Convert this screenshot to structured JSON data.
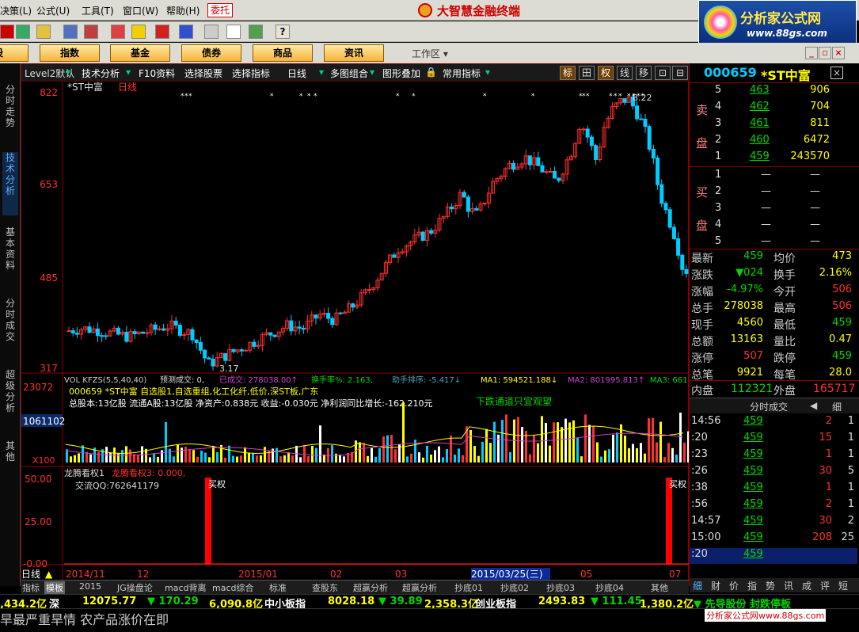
{
  "menu": {
    "items": [
      "决策(L)",
      "公式(U)",
      "工具(T)",
      "窗口(W)",
      "帮助(H)"
    ],
    "entrust": "委托",
    "app_title": "大智慧金融终端"
  },
  "brand": {
    "name": "分析家公式网",
    "url": "www.88gs.com"
  },
  "nav": {
    "buttons": [
      "股",
      "指数",
      "基金",
      "债券",
      "商品",
      "资讯"
    ],
    "workarea": "工作区"
  },
  "left_tabs": [
    "分时走势",
    "技术分析",
    "基本资料",
    "分时成交",
    "超级分析",
    "其他"
  ],
  "chart_tools": {
    "items": [
      "Level2默认",
      "技术分析",
      "F10资料",
      "选择股票",
      "选择指标",
      "日线",
      "多图组合",
      "图形叠加",
      "常用指标"
    ],
    "right": [
      "标",
      "田",
      "权",
      "线",
      "移",
      "⊡",
      "⊟"
    ]
  },
  "stock": {
    "code": "000659",
    "name": "*ST中富"
  },
  "chart_data": [
    {
      "type": "candlestick",
      "title": "*ST中富",
      "period": "日线",
      "y_ticks": [
        "822",
        "653",
        "485",
        "317"
      ],
      "ylim": [
        317,
        822
      ],
      "annotations": {
        "high": "8.22",
        "low": "3.17"
      },
      "x_ticks": [
        "2014/11",
        "12",
        "2015/01",
        "02",
        "03",
        "2015/03/25(三)",
        "05",
        "07"
      ]
    },
    {
      "type": "bar",
      "title": "VOL KFZS(5,5,40,40)",
      "y_ticks": [
        "23072",
        "1061102",
        "X100"
      ],
      "line1": {
        "l1": "预测成交: 0,",
        "l2": "已成交: 278038.00↑",
        "l3": "换手率%: 2.163,",
        "l4": "助手排序: -5.417↓",
        "l5": "MA1: 594521.188↓",
        "l6": "MA2: 801995.813↑",
        "l7": "MA3: 661"
      },
      "info1": "000659 *ST中富  自选股1,自选重组,化工化纤,低价,深ST板,广东",
      "info2": "总股本:13亿股  流通A股:13亿股   净资产:0.838元   收益:-0.030元   净利润同比增长:-162.210元",
      "info3": "下跌通道只宜观望"
    },
    {
      "type": "bar",
      "title": "龙腾看权1",
      "subtitle": "龙腾看权3: 0.000,",
      "note": "交流QQ:762641179",
      "y_ticks": [
        "50.00",
        "25.00",
        "-0.00"
      ],
      "bar_label": "买权",
      "signals": [
        {
          "x": "2014/12",
          "value": 100
        },
        {
          "x": "07",
          "value": 100
        }
      ]
    }
  ],
  "quote": {
    "sell": [
      {
        "level": "5",
        "price": "463",
        "vol": "906"
      },
      {
        "level": "4",
        "price": "462",
        "vol": "704"
      },
      {
        "level": "3",
        "price": "461",
        "vol": "811"
      },
      {
        "level": "2",
        "price": "460",
        "vol": "6472"
      },
      {
        "level": "1",
        "price": "459",
        "vol": "243570"
      }
    ],
    "buy": [
      {
        "level": "1",
        "price": "—",
        "vol": "—"
      },
      {
        "level": "2",
        "price": "—",
        "vol": "—"
      },
      {
        "level": "3",
        "price": "—",
        "vol": "—"
      },
      {
        "level": "4",
        "price": "—",
        "vol": "—"
      },
      {
        "level": "5",
        "price": "—",
        "vol": "—"
      }
    ],
    "sell_label": [
      "卖",
      "盘"
    ],
    "buy_label": [
      "买",
      "盘"
    ],
    "stats": [
      {
        "l": "最新",
        "v": "459",
        "l2": "均价",
        "v2": "473",
        "c": "#00d800",
        "c2": "#ffff00"
      },
      {
        "l": "涨跌",
        "v": "▼024",
        "l2": "换手",
        "v2": "2.16%",
        "c": "#00d800",
        "c2": "#ffff00"
      },
      {
        "l": "涨幅",
        "v": "-4.97%",
        "l2": "今开",
        "v2": "506",
        "c": "#00d800",
        "c2": "#ff3030"
      },
      {
        "l": "总手",
        "v": "278038",
        "l2": "最高",
        "v2": "506",
        "c": "#ffff00",
        "c2": "#ff3030"
      },
      {
        "l": "现手",
        "v": "4560",
        "l2": "最低",
        "v2": "459",
        "c": "#ffff00",
        "c2": "#00d800"
      },
      {
        "l": "总额",
        "v": "13163",
        "l2": "量比",
        "v2": "0.47",
        "c": "#ffff00",
        "c2": "#ffff00"
      },
      {
        "l": "涨停",
        "v": "507",
        "l2": "跌停",
        "v2": "459",
        "c": "#ff3030",
        "c2": "#00d800"
      },
      {
        "l": "总笔",
        "v": "9921",
        "l2": "每笔",
        "v2": "28.0",
        "c": "#ffff00",
        "c2": "#ffff00"
      }
    ],
    "inner_label": "内盘",
    "inner": "112321",
    "outer_label": "外盘",
    "outer": "165717",
    "ticks_title": "分时成交",
    "ticks_more": "细",
    "ticks": [
      {
        "t": "14:56",
        "p": "459",
        "v": "2",
        "n": "1"
      },
      {
        "t": ":20",
        "p": "459",
        "v": "15",
        "n": "1"
      },
      {
        "t": ":23",
        "p": "459",
        "v": "1",
        "n": "1"
      },
      {
        "t": ":26",
        "p": "459",
        "v": "30",
        "n": "5"
      },
      {
        "t": ":38",
        "p": "459",
        "v": "1",
        "n": "1"
      },
      {
        "t": ":56",
        "p": "459",
        "v": "2",
        "n": "1"
      },
      {
        "t": "14:57",
        "p": "459",
        "v": "30",
        "n": "2"
      },
      {
        "t": "15:00",
        "p": "459",
        "v": "208",
        "n": "25"
      },
      {
        "t": ":20",
        "p": "459",
        "v": "",
        "n": ""
      }
    ],
    "bottom_tabs": [
      "细",
      "财",
      "价",
      "指",
      "势",
      "讯",
      "成",
      "评",
      "短"
    ]
  },
  "bottom_tabs": [
    "指标",
    "模板",
    "2015",
    "JG操盘论",
    "macd背离",
    "macd综合",
    "标准",
    "查股东",
    "超赢分析",
    "超赢分析",
    "抄底01",
    "抄底02",
    "抄底03",
    "抄底04",
    "其他"
  ],
  "ticker": [
    {
      "t": ",434.2亿",
      "c": "#ffff00"
    },
    {
      "t": "深",
      "c": "#ffffff"
    },
    {
      "t": "12075.77",
      "c": "#ffff00"
    },
    {
      "t": "▼ 170.29",
      "c": "#00d800"
    },
    {
      "t": "6,090.8亿",
      "c": "#ffff00"
    },
    {
      "t": "中小板指",
      "c": "#ffffff"
    },
    {
      "t": "8028.18",
      "c": "#ffff00"
    },
    {
      "t": "▼ 39.89",
      "c": "#00d800"
    },
    {
      "t": "2,358.3亿",
      "c": "#ffff00"
    },
    {
      "t": "创业板指",
      "c": "#ffffff"
    },
    {
      "t": "2493.83",
      "c": "#ffff00"
    },
    {
      "t": "▼ 111.45",
      "c": "#00d800"
    },
    {
      "t": "1,380.2亿",
      "c": "#ffff00"
    },
    {
      "t": "▼ 先导股份 封跌停板",
      "c": "#00d800"
    }
  ],
  "news": "旱最严重旱情 农产品涨价在即",
  "footer_brand": "分析家公式网www.88gs.com"
}
